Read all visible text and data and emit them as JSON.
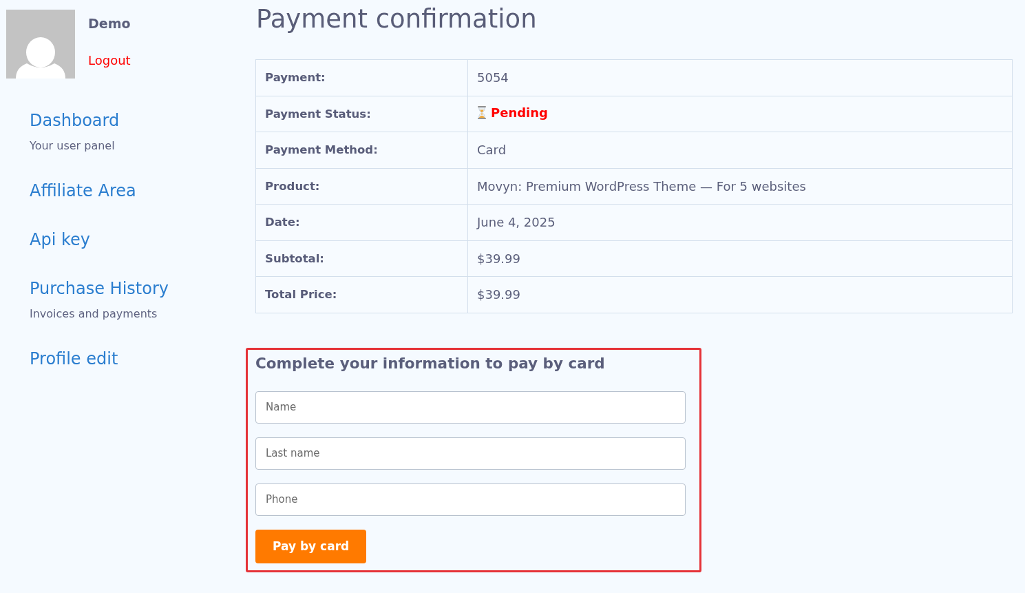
{
  "user": {
    "name": "Demo",
    "logout": "Logout"
  },
  "sidebar": {
    "items": [
      {
        "label": "Dashboard",
        "subtitle": "Your user panel"
      },
      {
        "label": "Affiliate Area"
      },
      {
        "label": "Api key"
      },
      {
        "label": "Purchase History",
        "subtitle": "Invoices and payments"
      },
      {
        "label": "Profile edit"
      }
    ]
  },
  "page_title": "Payment confirmation",
  "details": {
    "rows": [
      {
        "label": "Payment:",
        "value": "5054",
        "kind": "text"
      },
      {
        "label": "Payment Status:",
        "value": "Pending",
        "kind": "status"
      },
      {
        "label": "Payment Method:",
        "value": "Card",
        "kind": "text"
      },
      {
        "label": "Product:",
        "value": "Movyn: Premium WordPress Theme — For 5 websites",
        "kind": "text"
      },
      {
        "label": "Date:",
        "value": "June 4, 2025",
        "kind": "text"
      },
      {
        "label": "Subtotal:",
        "value": "$39.99",
        "kind": "text"
      },
      {
        "label": "Total Price:",
        "value": "$39.99",
        "kind": "text"
      }
    ]
  },
  "card_form": {
    "title": "Complete your information to pay by card",
    "fields": [
      {
        "placeholder": "Name"
      },
      {
        "placeholder": "Last name"
      },
      {
        "placeholder": "Phone"
      }
    ],
    "submit": "Pay by card"
  }
}
